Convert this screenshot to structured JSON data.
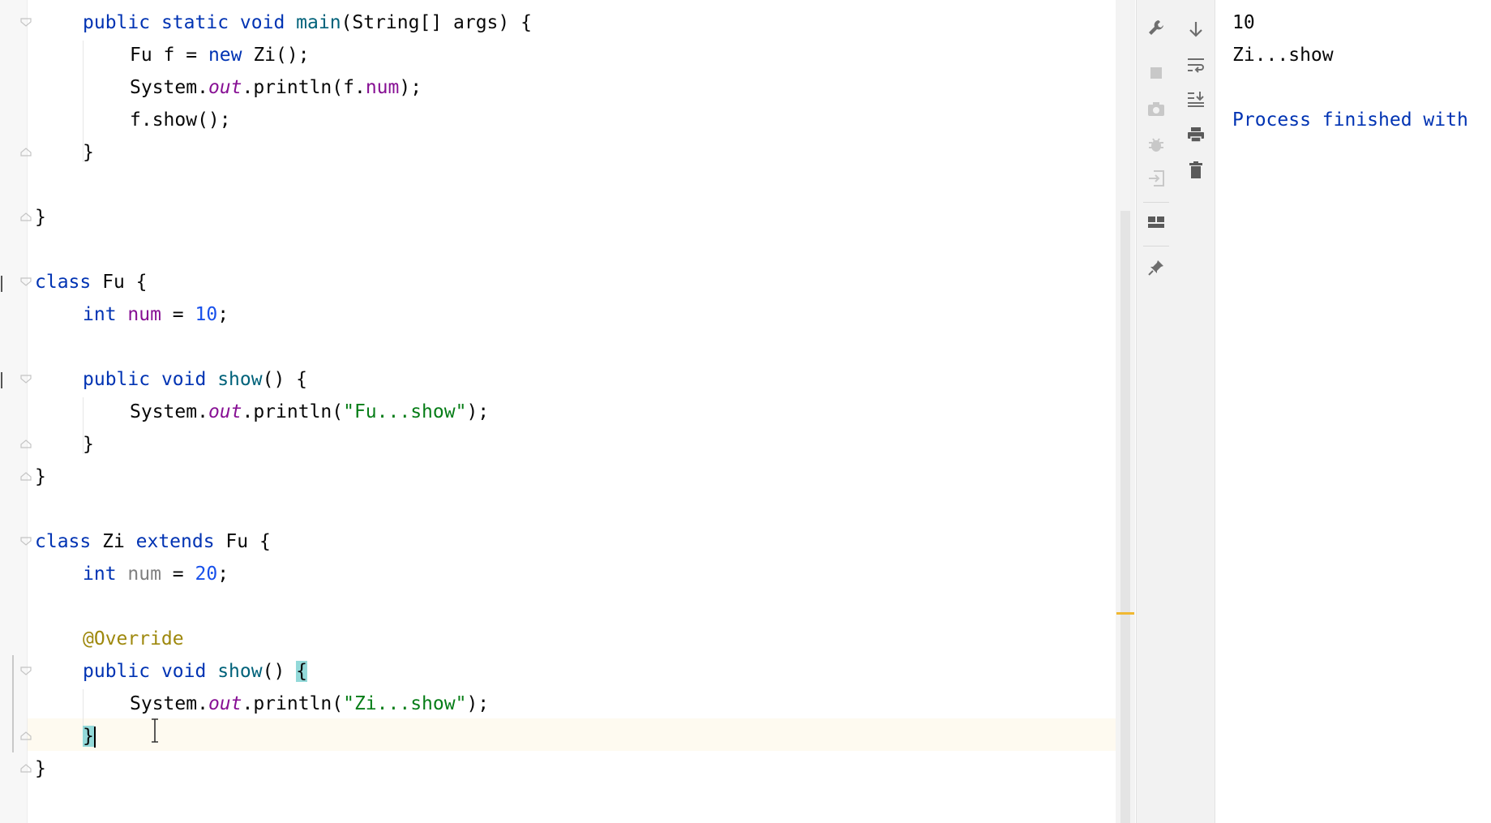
{
  "editor": {
    "lines": {
      "main_sig": {
        "kw1": "public",
        "kw2": "static",
        "kw3": "void",
        "name": "main",
        "params": "(String[] args) {"
      },
      "decl_f": {
        "type": "Fu f = ",
        "kw": "new",
        "rest": " Zi();"
      },
      "println_num": {
        "pre": "System.",
        "out": "out",
        "mid": ".println(f.",
        "fld": "num",
        "end": ");"
      },
      "call_show": {
        "text": "f.show();"
      },
      "brace_close": "}",
      "class_fu": {
        "kw": "class",
        "rest": " Fu {"
      },
      "fu_field": {
        "kw": "int",
        "name": "num",
        "eq": " = ",
        "val": "10",
        "end": ";"
      },
      "fu_show_sig": {
        "kw1": "public",
        "kw2": "void",
        "name": "show",
        "end": "() {"
      },
      "fu_println": {
        "pre": "System.",
        "out": "out",
        "mid": ".println(",
        "str": "\"Fu...show\"",
        "end": ");"
      },
      "class_zi": {
        "kw": "class",
        "mid": " Zi ",
        "kw2": "extends",
        "rest": " Fu {"
      },
      "zi_field": {
        "kw": "int",
        "name": "num",
        "eq": " = ",
        "val": "20",
        "end": ";"
      },
      "annotation": "@Override",
      "zi_show_sig": {
        "kw1": "public",
        "kw2": "void",
        "name": "show",
        "mid": "() ",
        "brace": "{"
      },
      "zi_println": {
        "pre": "System.",
        "out": "out",
        "mid": ".println(",
        "str": "\"Zi...show\"",
        "end": ");"
      }
    }
  },
  "console": {
    "lines": [
      "10",
      "Zi...show",
      "",
      "Process finished with"
    ]
  },
  "toolbar_left": [
    "wrench-icon",
    "stop-icon",
    "camera-icon",
    "debug-icon",
    "exit-icon",
    "layout-icon",
    "pin-icon"
  ],
  "toolbar_right": [
    "down-arrow-icon",
    "soft-wrap-icon",
    "scroll-to-end-icon",
    "print-icon",
    "trash-icon"
  ],
  "colors": {
    "keyword": "#0033b3",
    "method": "#00627a",
    "field": "#871094",
    "number": "#1750eb",
    "string": "#067d17",
    "annotation": "#9e880d",
    "brace_match": "#93d9d9",
    "caret_row": "#fefaf0",
    "warning_stripe": "#f0b832"
  }
}
